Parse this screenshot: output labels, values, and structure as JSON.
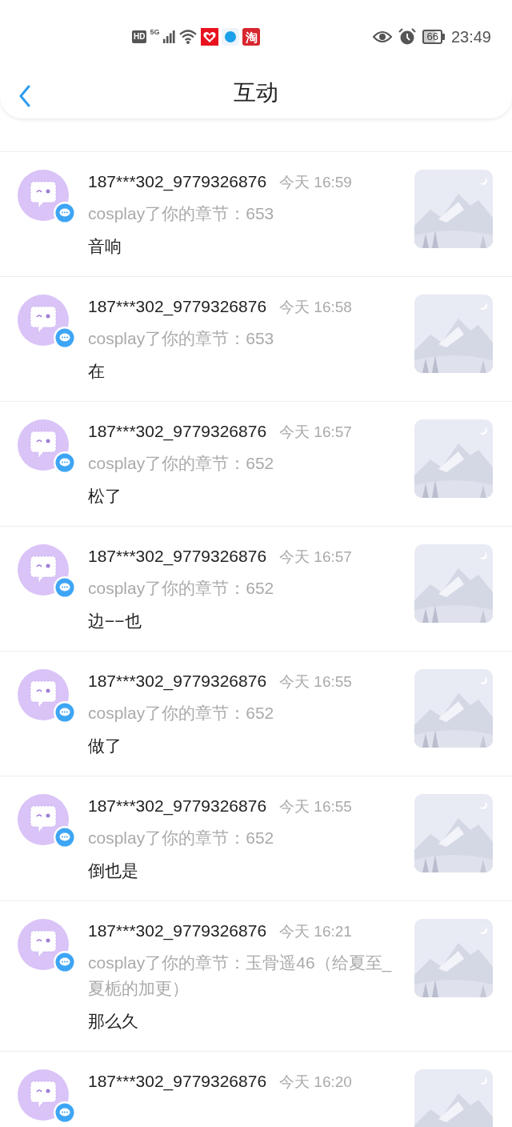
{
  "status_bar": {
    "hd": "HD",
    "network": "5G",
    "taobao": "淘",
    "battery": "66",
    "time": "23:49"
  },
  "header": {
    "title": "互动"
  },
  "items": [
    {
      "user": "187***302_9779326876",
      "time": "今天 16:59",
      "action": "cosplay了你的章节：653",
      "comment": "音响"
    },
    {
      "user": "187***302_9779326876",
      "time": "今天 16:58",
      "action": "cosplay了你的章节：653",
      "comment": "在"
    },
    {
      "user": "187***302_9779326876",
      "time": "今天 16:57",
      "action": "cosplay了你的章节：652",
      "comment": "松了"
    },
    {
      "user": "187***302_9779326876",
      "time": "今天 16:57",
      "action": "cosplay了你的章节：652",
      "comment": "边−−也"
    },
    {
      "user": "187***302_9779326876",
      "time": "今天 16:55",
      "action": "cosplay了你的章节：652",
      "comment": "做了"
    },
    {
      "user": "187***302_9779326876",
      "time": "今天 16:55",
      "action": "cosplay了你的章节：652",
      "comment": "倒也是"
    },
    {
      "user": "187***302_9779326876",
      "time": "今天 16:21",
      "action": "cosplay了你的章节：玉骨遥46（给夏至_夏栀的加更）",
      "comment": "那么久"
    },
    {
      "user": "187***302_9779326876",
      "time": "今天 16:20"
    }
  ]
}
